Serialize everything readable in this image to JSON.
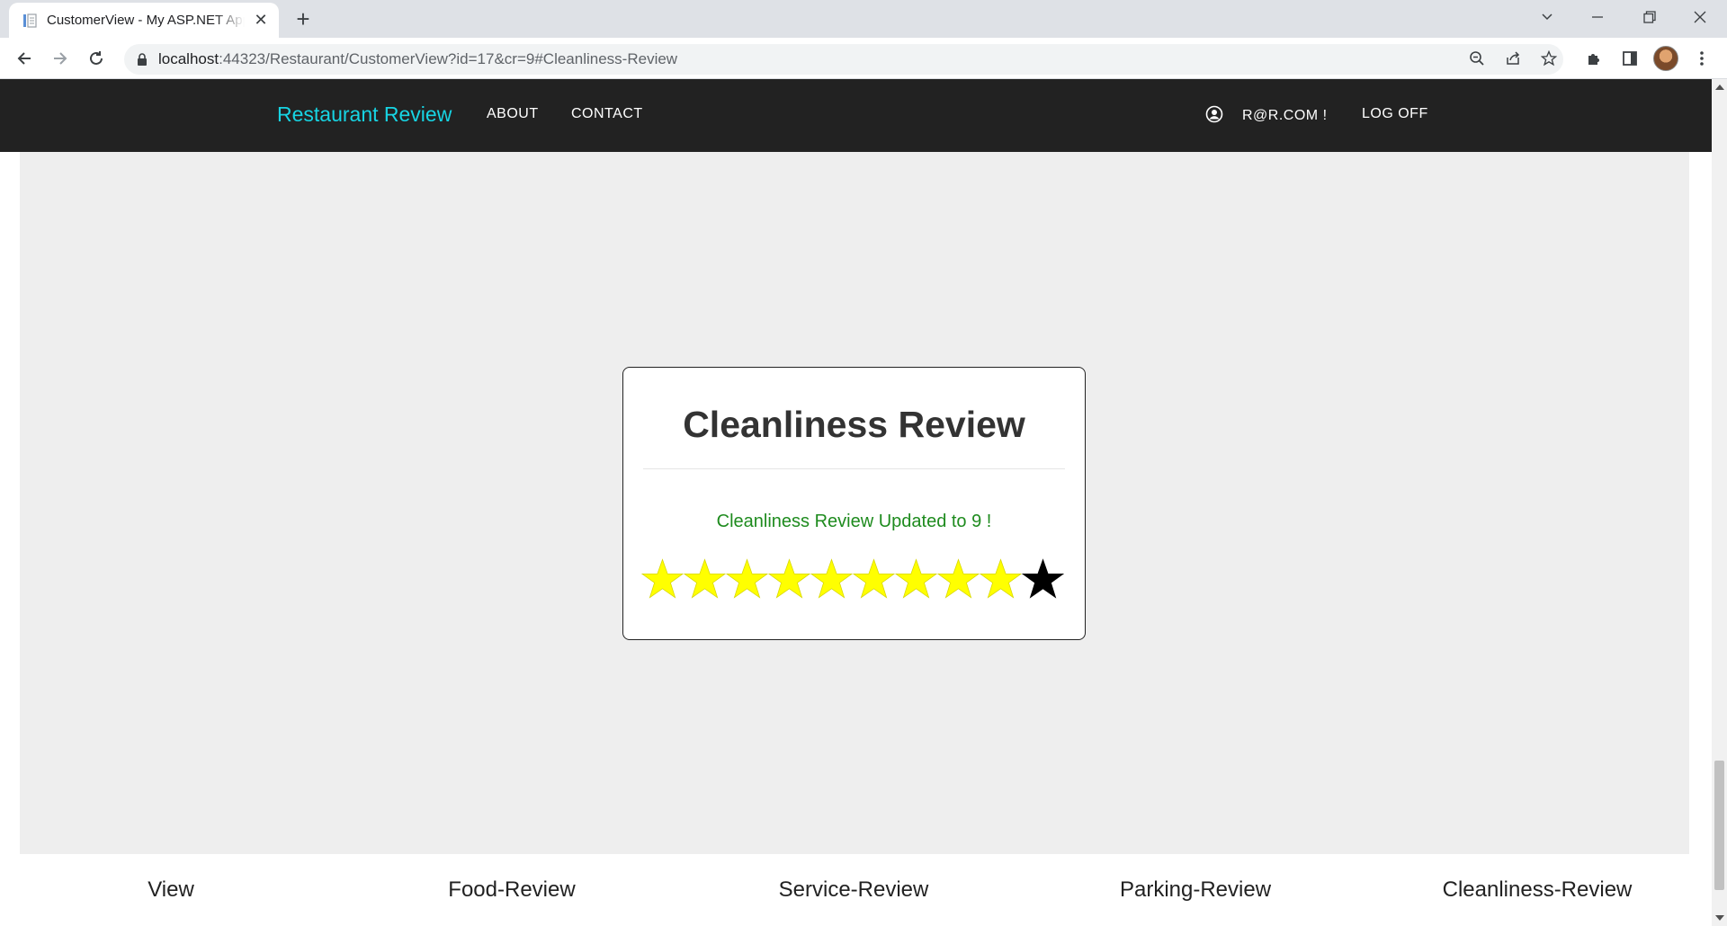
{
  "browser": {
    "tab_title": "CustomerView - My ASP.NET Application",
    "url_host": "localhost",
    "url_rest": ":44323/Restaurant/CustomerView?id=17&cr=9#Cleanliness-Review"
  },
  "navbar": {
    "brand": "Restaurant Review",
    "about": "ABOUT",
    "contact": "CONTACT",
    "user": "R@R.COM !",
    "logoff": "LOG OFF"
  },
  "card": {
    "title": "Cleanliness Review",
    "message": "Cleanliness Review Updated to 9 !",
    "rating": 9,
    "max_rating": 10,
    "filled_color": "#ffff00",
    "empty_color": "#000000"
  },
  "footer": {
    "links": [
      "View",
      "Food-Review",
      "Service-Review",
      "Parking-Review",
      "Cleanliness-Review"
    ]
  }
}
